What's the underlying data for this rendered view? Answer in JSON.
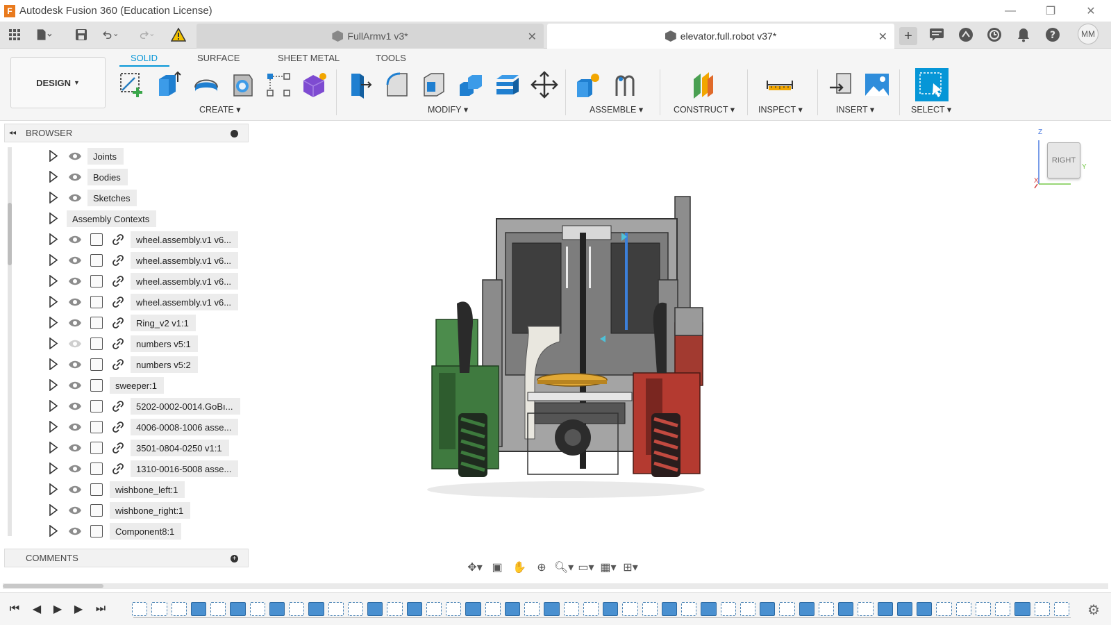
{
  "app": {
    "title": "Autodesk Fusion 360 (Education License)",
    "logo_letter": "F",
    "window_controls": [
      "—",
      "❐",
      "✕"
    ]
  },
  "quick_access": {
    "icons": [
      "grid-icon",
      "file-icon",
      "save-icon",
      "undo-icon",
      "redo-icon",
      "warning-icon"
    ]
  },
  "tabs": [
    {
      "label": "FullArmv1 v3*",
      "active": false
    },
    {
      "label": "elevator.full.robot v37*",
      "active": true
    }
  ],
  "top_right": {
    "icons": [
      "new-tab-icon",
      "chat-icon",
      "extensions-icon",
      "history-icon",
      "notifications-icon",
      "help-icon"
    ],
    "avatar": "MM"
  },
  "toolbar": {
    "workspace": "DESIGN",
    "workspace_tabs": [
      "SOLID",
      "SURFACE",
      "SHEET METAL",
      "TOOLS"
    ],
    "active_tab": "SOLID",
    "groups": [
      {
        "label": "CREATE"
      },
      {
        "label": "MODIFY"
      },
      {
        "label": "ASSEMBLE"
      },
      {
        "label": "CONSTRUCT"
      },
      {
        "label": "INSPECT"
      },
      {
        "label": "INSERT"
      },
      {
        "label": "SELECT"
      }
    ],
    "dropdown_caret": "▾"
  },
  "browser": {
    "title": "BROWSER",
    "collapse_icon": "◂◂",
    "items": [
      {
        "label": "Joints",
        "type": "folder",
        "visible": true,
        "link": false
      },
      {
        "label": "Bodies",
        "type": "folder",
        "visible": true,
        "link": false
      },
      {
        "label": "Sketches",
        "type": "folder",
        "visible": true,
        "link": false
      },
      {
        "label": "Assembly Contexts",
        "type": "folder",
        "visible": null,
        "link": false
      },
      {
        "label": "wheel.assembly.v1 v6...",
        "type": "component",
        "visible": true,
        "link": true
      },
      {
        "label": "wheel.assembly.v1 v6...",
        "type": "component",
        "visible": true,
        "link": true
      },
      {
        "label": "wheel.assembly.v1 v6...",
        "type": "component",
        "visible": true,
        "link": true
      },
      {
        "label": "wheel.assembly.v1 v6...",
        "type": "component",
        "visible": true,
        "link": true
      },
      {
        "label": "Ring_v2 v1:1",
        "type": "component",
        "visible": true,
        "link": true
      },
      {
        "label": "numbers v5:1",
        "type": "component",
        "visible": false,
        "link": true
      },
      {
        "label": "numbers v5:2",
        "type": "component",
        "visible": true,
        "link": true
      },
      {
        "label": "sweeper:1",
        "type": "component",
        "visible": true,
        "link": false
      },
      {
        "label": "5202-0002-0014.GoBı...",
        "type": "component",
        "visible": true,
        "link": true
      },
      {
        "label": "4006-0008-1006 asse...",
        "type": "component",
        "visible": true,
        "link": true
      },
      {
        "label": "3501-0804-0250 v1:1",
        "type": "component",
        "visible": true,
        "link": true
      },
      {
        "label": "1310-0016-5008 asse...",
        "type": "component",
        "visible": true,
        "link": true
      },
      {
        "label": "wishbone_left:1",
        "type": "component",
        "visible": true,
        "link": false
      },
      {
        "label": "wishbone_right:1",
        "type": "component",
        "visible": true,
        "link": false
      },
      {
        "label": "Component8:1",
        "type": "component",
        "visible": true,
        "link": false
      }
    ]
  },
  "comments": {
    "title": "COMMENTS"
  },
  "viewcube": {
    "face": "RIGHT",
    "axis_z": "Z",
    "axis_y": "Y",
    "axis_x": "X"
  },
  "colors": {
    "accent": "#0696d7",
    "green_part": "#3f7a3f",
    "red_part": "#b43a30",
    "gold_part": "#e2a936"
  }
}
